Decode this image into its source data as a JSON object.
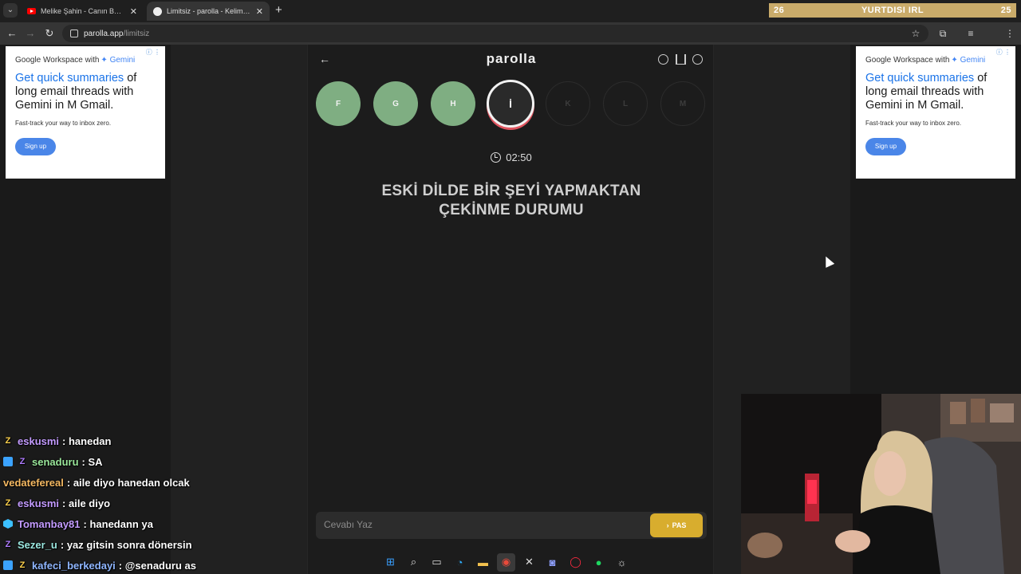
{
  "browser": {
    "tabs": [
      {
        "title": "Melike Şahin - Canın Beni Çekti",
        "active": false
      },
      {
        "title": "Limitsiz - parolla - Kelime oyunu",
        "active": true
      }
    ],
    "close_glyph": "✕",
    "new_tab_glyph": "+",
    "url_domain": "parolla.app",
    "url_path": "/limitsiz"
  },
  "stream_banner": {
    "left_number": "26",
    "title": "YURTDISI IRL",
    "right_number": "25"
  },
  "ads": {
    "brand": "Google Workspace with",
    "brand_gemini": "✦ Gemini",
    "headline_highlight": "Get quick summaries",
    "headline_rest_1": " of long email threads with Gemini in ",
    "gmail": "M Gmail.",
    "subtext": "Fast-track your way to inbox zero.",
    "cta": "Sign up",
    "adchoices": "ⓘ ⋮"
  },
  "game": {
    "logo": "parolla",
    "letters": [
      {
        "char": "F",
        "state": "done"
      },
      {
        "char": "G",
        "state": "done"
      },
      {
        "char": "H",
        "state": "done"
      },
      {
        "char": "İ",
        "state": "current"
      },
      {
        "char": "K",
        "state": "todo"
      },
      {
        "char": "L",
        "state": "todo"
      },
      {
        "char": "M",
        "state": "todo"
      }
    ],
    "timer": "02:50",
    "question_line1": "ESKİ DİLDE BİR ŞEYİ YAPMAKTAN",
    "question_line2": "ÇEKİNME DURUMU",
    "answer_placeholder": "Cevabı Yaz",
    "pass_label": "PAS",
    "colors": {
      "done": "#7fae82",
      "current_ring": "#e05560",
      "pass": "#d8ad2e"
    }
  },
  "chat": [
    {
      "user": "eskusmi",
      "color": "#c39bff",
      "badge": "z",
      "text": ": hanedan"
    },
    {
      "user": "senaduru",
      "color": "#9be79b",
      "badge": "blue-z",
      "text": ": SA"
    },
    {
      "user": "vedatefereal",
      "color": "#f5b962",
      "badge": "none",
      "text": ": aile diyo hanedan olcak"
    },
    {
      "user": "eskusmi",
      "color": "#c39bff",
      "badge": "z",
      "text": ": aile diyo"
    },
    {
      "user": "Tomanbay81",
      "color": "#c39bff",
      "badge": "cube",
      "text": ": hanedann ya"
    },
    {
      "user": "Sezer_u",
      "color": "#9be7e0",
      "badge": "z-purple",
      "text": ": yaz gitsin sonra dönersin"
    },
    {
      "user": "kafeci_berkedayi",
      "color": "#8fb6ff",
      "badge": "blue-z",
      "text": ": @senaduru as"
    }
  ]
}
